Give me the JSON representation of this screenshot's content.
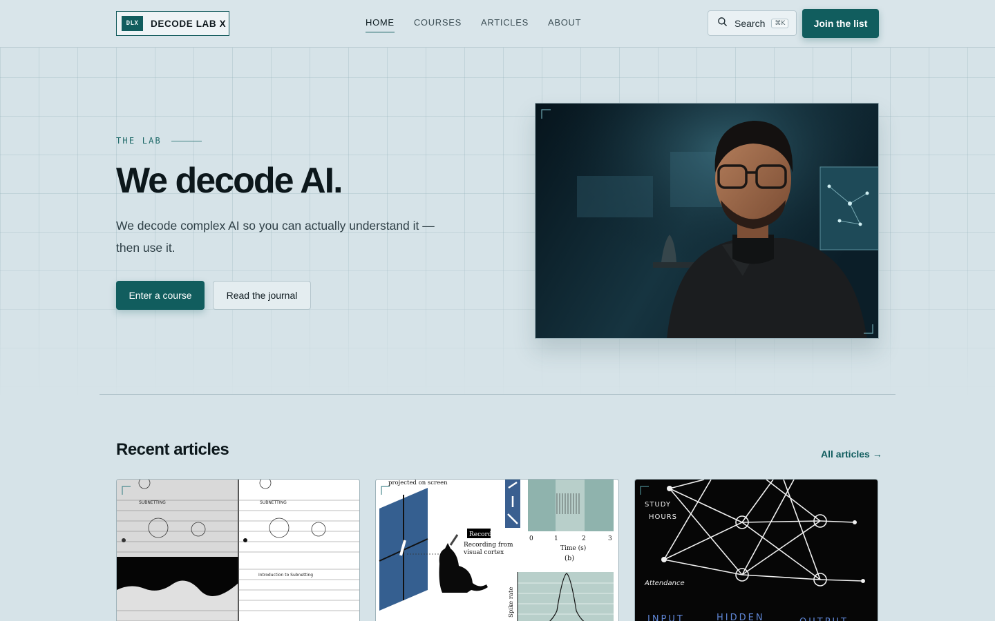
{
  "brand": {
    "mark": "DLX",
    "name": "DECODE LAB X"
  },
  "nav": {
    "items": [
      {
        "label": "HOME",
        "active": true
      },
      {
        "label": "COURSES",
        "active": false
      },
      {
        "label": "ARTICLES",
        "active": false
      },
      {
        "label": "ABOUT",
        "active": false
      }
    ]
  },
  "search": {
    "label": "Search",
    "shortcut": "⌘K"
  },
  "header": {
    "cta_label": "Join the list"
  },
  "hero": {
    "eyebrow": "THE LAB",
    "title": "We decode AI.",
    "subtitle": "We decode complex AI so you can actually understand it — then use it.",
    "primary_cta": "Enter a course",
    "secondary_cta": "Read the journal"
  },
  "articles": {
    "section_title": "Recent articles",
    "all_link": "All articles →",
    "cards": [
      {
        "kind": "handwritten-notes-scan",
        "lettering": [
          "SUBNETTING",
          "Introduction to Subnetting"
        ]
      },
      {
        "kind": "neuroscience-figure",
        "lettering": [
          "projected on screen",
          "Record",
          "Recording from",
          "visual cortex",
          "0",
          "1",
          "2",
          "3",
          "Time (s)",
          "(b)",
          "Spike rate"
        ]
      },
      {
        "kind": "neural-network-sketch",
        "lettering": [
          "STUDY",
          "HOURS",
          "Attendance",
          "INPUT",
          "HIDDEN",
          "OUTPUT"
        ]
      }
    ]
  },
  "colors": {
    "accent": "#115d5e",
    "background": "#d6e3e8",
    "text": "#0c171b"
  }
}
